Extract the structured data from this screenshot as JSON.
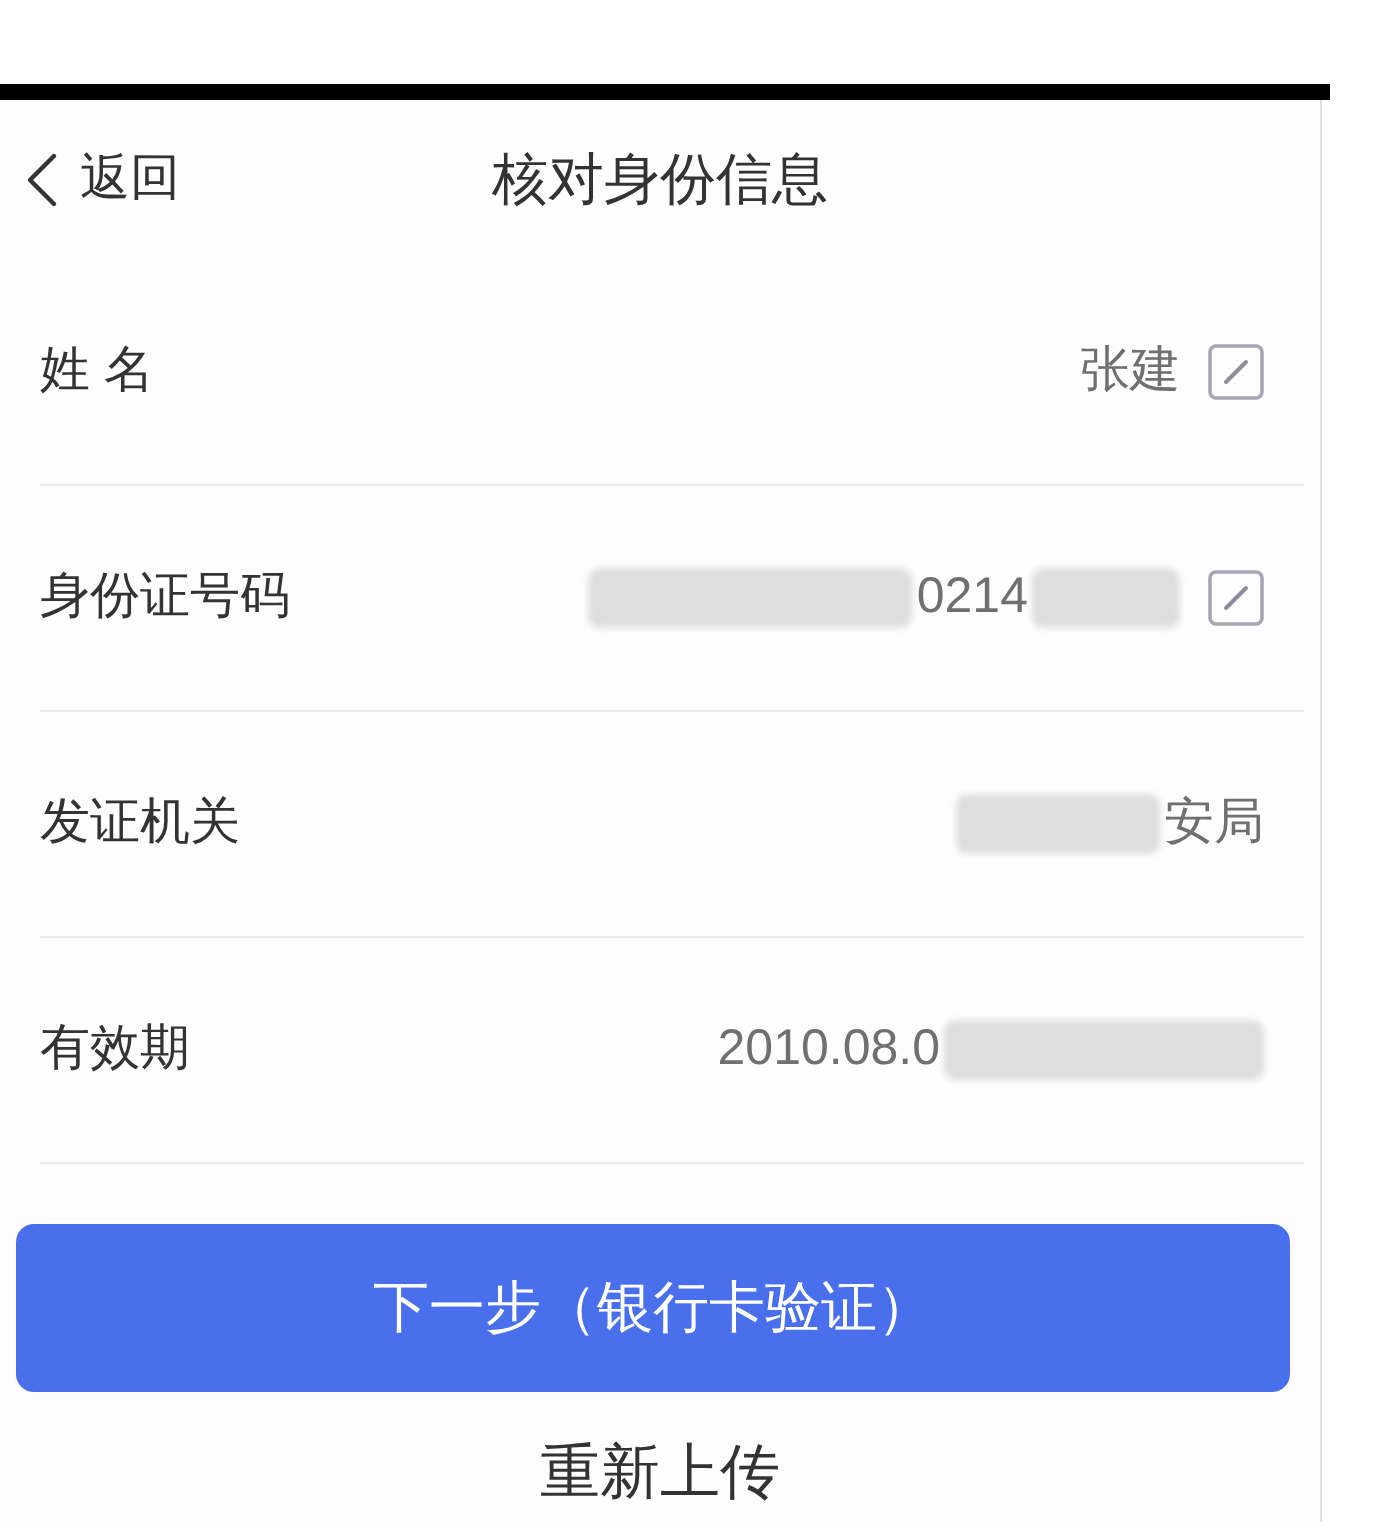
{
  "header": {
    "back_label": "返回",
    "title": "核对身份信息"
  },
  "fields": [
    {
      "label": "姓 名",
      "value": "张建",
      "editable": true,
      "masked_before": false,
      "masked_after": false
    },
    {
      "label": "身份证号码",
      "value": "0214",
      "editable": true,
      "masked_before": true,
      "masked_after": true
    },
    {
      "label": "发证机关",
      "value": "安局",
      "editable": false,
      "masked_before": true,
      "masked_after": false
    },
    {
      "label": "有效期",
      "value": "2010.08.0",
      "editable": false,
      "masked_before": false,
      "masked_after": true
    }
  ],
  "primary_button": "下一步（银行卡验证）",
  "secondary_button": "重新上传"
}
